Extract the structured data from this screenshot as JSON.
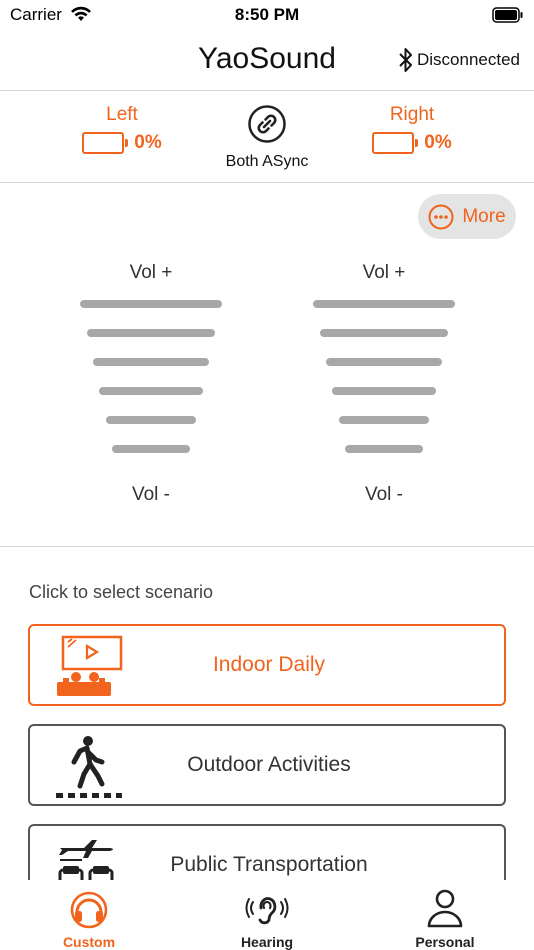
{
  "status_bar": {
    "carrier": "Carrier",
    "time": "8:50 PM"
  },
  "header": {
    "title": "YaoSound",
    "bluetooth_status": "Disconnected"
  },
  "earbuds": {
    "left": {
      "label": "Left",
      "battery": "0%"
    },
    "right": {
      "label": "Right",
      "battery": "0%"
    },
    "sync_label": "Both ASync"
  },
  "more_button": {
    "label": "More"
  },
  "volume": {
    "left": {
      "up_label": "Vol +",
      "down_label": "Vol -"
    },
    "right": {
      "up_label": "Vol +",
      "down_label": "Vol -"
    }
  },
  "scenario": {
    "prompt": "Click to select scenario",
    "items": [
      {
        "label": "Indoor Daily",
        "icon": "tv-living-room-icon",
        "selected": true
      },
      {
        "label": "Outdoor Activities",
        "icon": "walking-person-icon",
        "selected": false
      },
      {
        "label": "Public Transportation",
        "icon": "airplane-seats-icon",
        "selected": false
      }
    ]
  },
  "tabs": [
    {
      "label": "Custom",
      "icon": "headphones-icon",
      "active": true
    },
    {
      "label": "Hearing",
      "icon": "ear-icon",
      "active": false
    },
    {
      "label": "Personal",
      "icon": "person-icon",
      "active": false
    }
  ],
  "colors": {
    "accent": "#f0641e",
    "bar": "#a8a8a8",
    "more_bg": "#e4e4e4"
  }
}
